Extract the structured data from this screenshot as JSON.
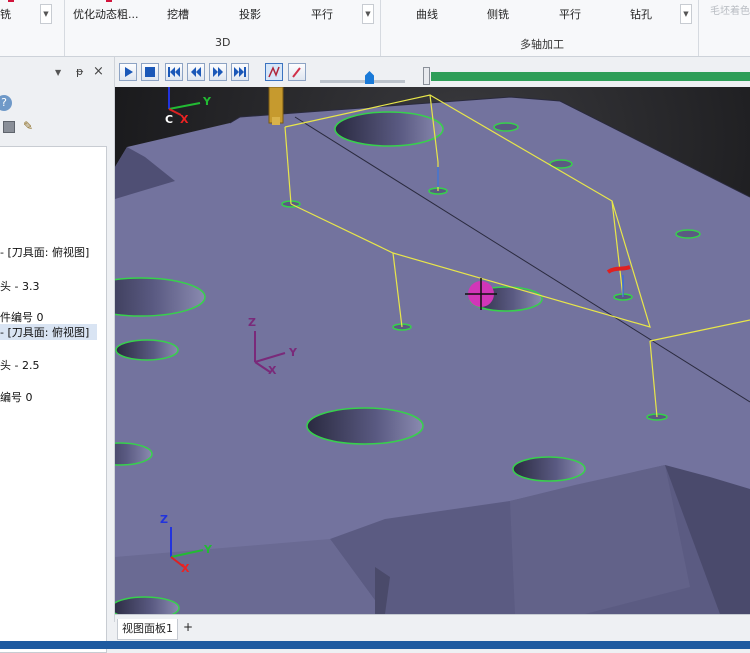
{
  "ribbon": {
    "cut_item": "铣",
    "item_rough": "优化动态粗...",
    "item_pocket": "挖槽",
    "item_project": "投影",
    "item_parallel": "平行",
    "group_3d": "3D",
    "item_curve": "曲线",
    "item_side": "侧铣",
    "item_parallel2": "平行",
    "item_drill": "钻孔",
    "group_multiaxis": "多轴加工",
    "cut_right": "毛坯着色"
  },
  "tree": {
    "items": [
      "- [刀具面: 俯视图]",
      "头 - 3.3",
      "件编号 0",
      "- [刀具面: 俯视图]",
      "头 - 2.5",
      "编号 0"
    ]
  },
  "axes": {
    "x": "X",
    "y": "Y",
    "z": "Z",
    "c": "C"
  },
  "tabs": {
    "viewport_tab": "视图面板1",
    "add": "+"
  },
  "colors": {
    "part": "#73739e",
    "hole_outline": "#37d14c",
    "toolpath": "#e8e64a",
    "background": "#1f1f22",
    "status_bar": "#1e5aa0",
    "slider_thumb": "#1a7ad8",
    "progress": "#2e9e58"
  }
}
